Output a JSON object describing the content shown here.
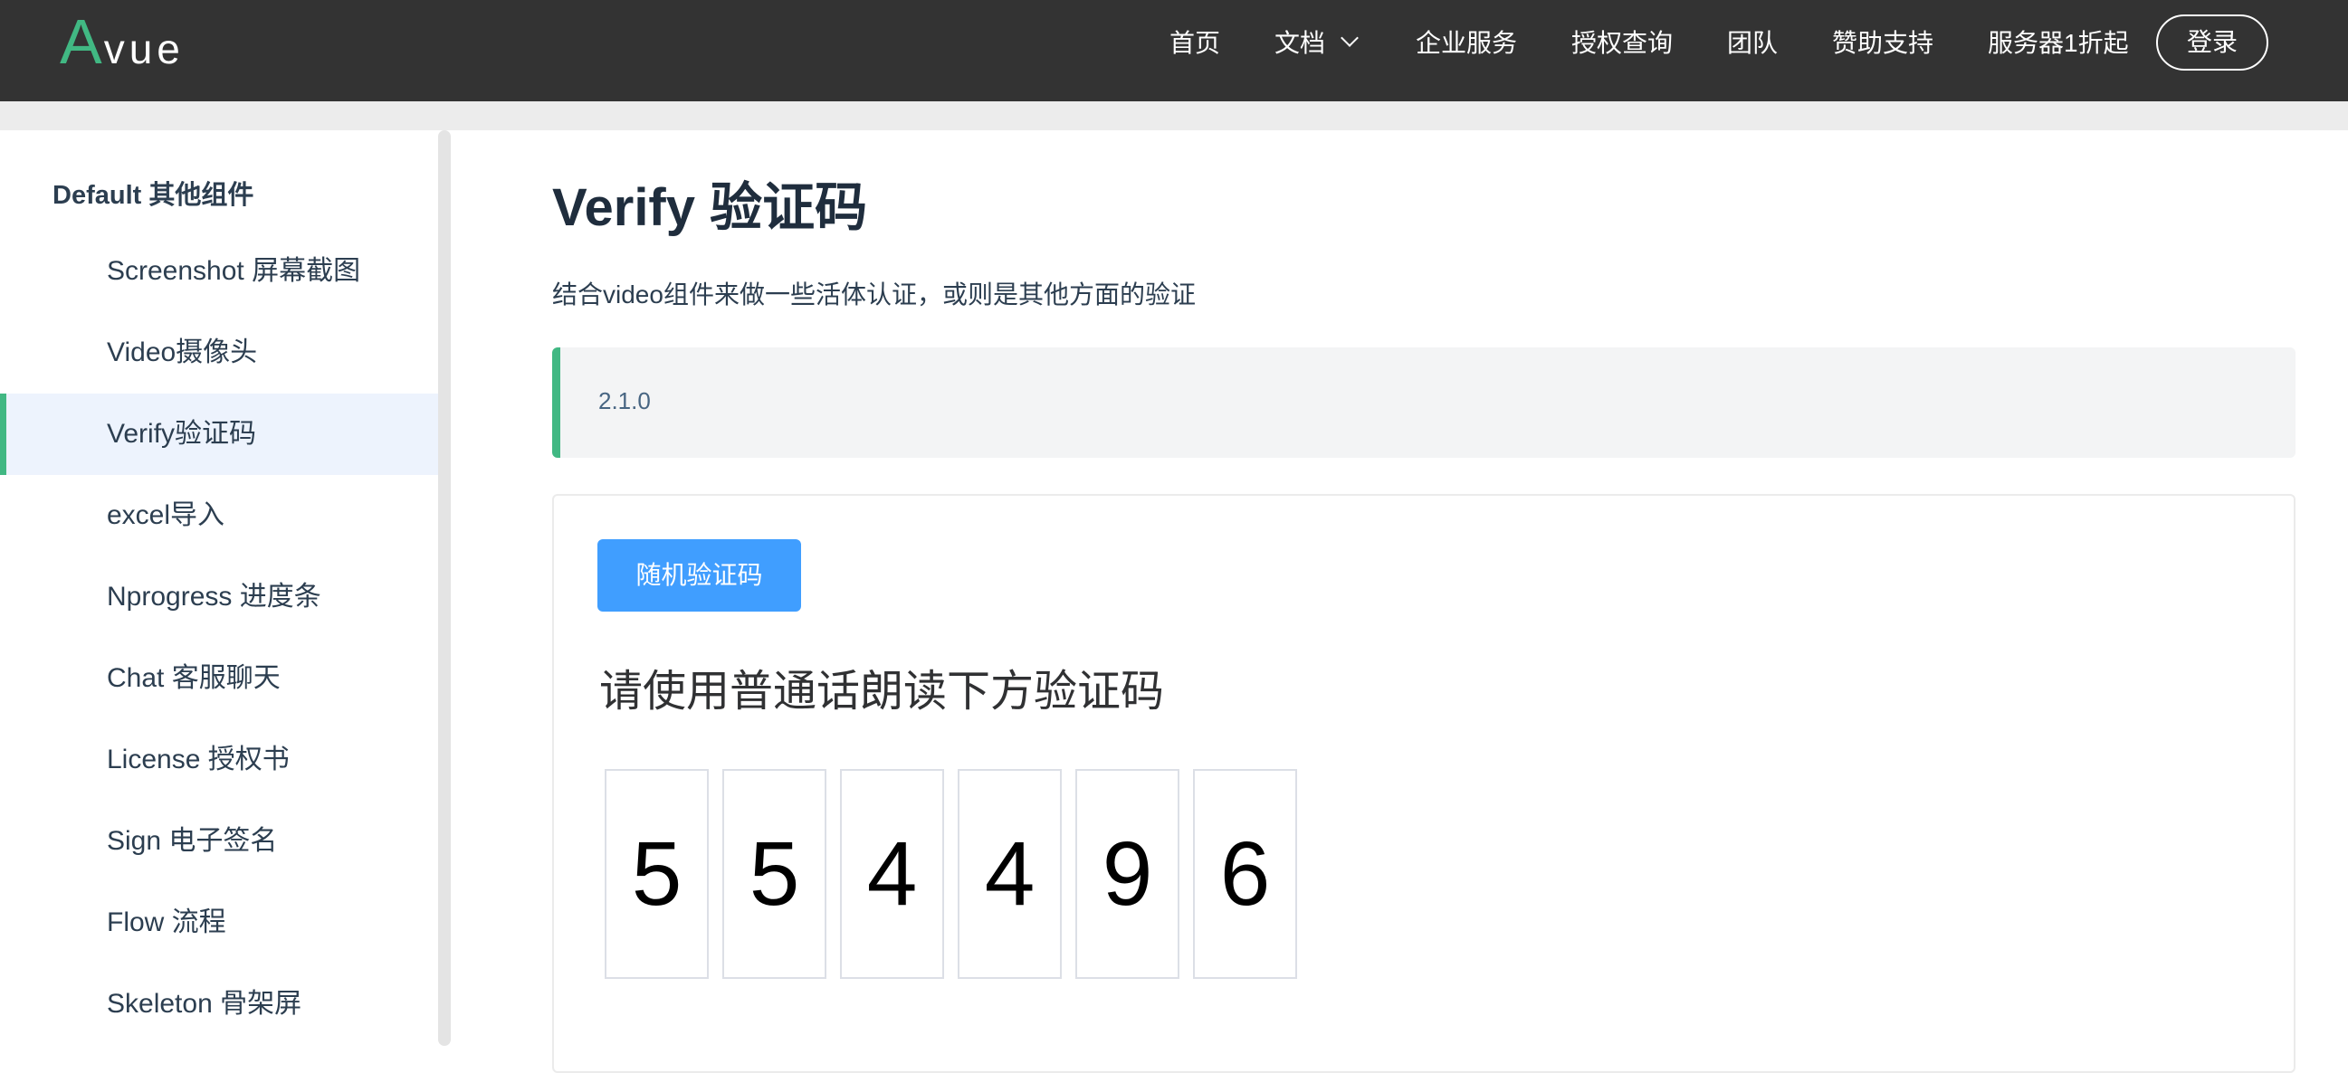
{
  "header": {
    "logo_a": "A",
    "logo_rest": "vue",
    "nav": [
      {
        "label": "首页"
      },
      {
        "label": "文档"
      },
      {
        "label": "企业服务"
      },
      {
        "label": "授权查询"
      },
      {
        "label": "团队"
      },
      {
        "label": "赞助支持"
      },
      {
        "label": "服务器1折起"
      }
    ],
    "login_label": "登录"
  },
  "sidebar": {
    "group_title": "Default 其他组件",
    "items": [
      {
        "label": "Screenshot 屏幕截图"
      },
      {
        "label": "Video摄像头"
      },
      {
        "label": "Verify验证码"
      },
      {
        "label": "excel导入"
      },
      {
        "label": "Nprogress 进度条"
      },
      {
        "label": "Chat 客服聊天"
      },
      {
        "label": "License 授权书"
      },
      {
        "label": "Sign 电子签名"
      },
      {
        "label": "Flow 流程"
      },
      {
        "label": "Skeleton 骨架屏"
      }
    ],
    "active_index": 2
  },
  "main": {
    "title": "Verify 验证码",
    "description": "结合video组件来做一些活体认证，或则是其他方面的验证",
    "version": "2.1.0",
    "random_button_label": "随机验证码",
    "verify_prompt": "请使用普通话朗读下方验证码",
    "digits": [
      "5",
      "5",
      "4",
      "4",
      "9",
      "6"
    ]
  },
  "colors": {
    "accent_green": "#41b883",
    "button_blue": "#409eff",
    "navbar_bg": "#333333",
    "active_item_bg": "#edf3fd"
  }
}
